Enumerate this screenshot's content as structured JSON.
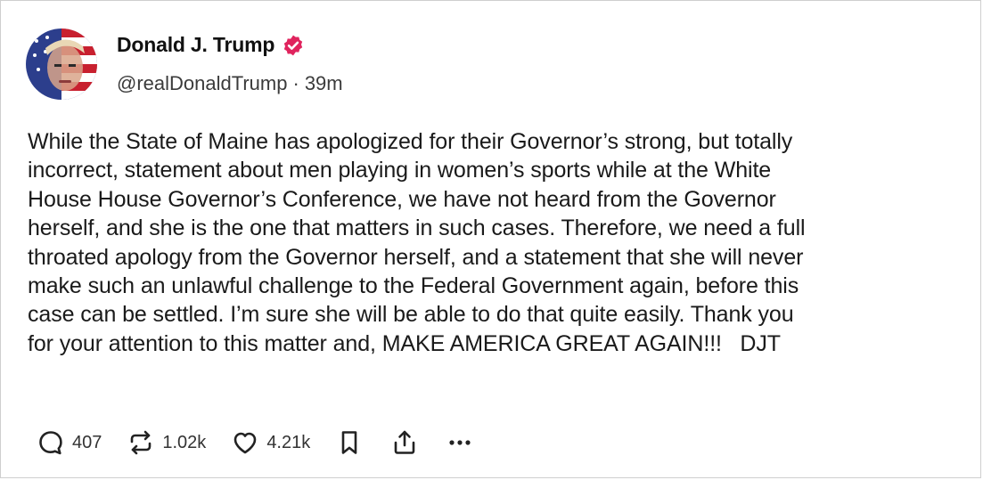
{
  "author": {
    "display_name": "Donald J. Trump",
    "handle": "@realDonaldTrump",
    "separator": "·",
    "time_ago": "39m",
    "verified": true,
    "verified_color": "#e0245e"
  },
  "post": {
    "text": "While the State of Maine has apologized for their Governor’s strong, but totally\nincorrect, statement about men playing in women’s sports while at the White\nHouse House Governor’s Conference, we have not heard from the Governor\nherself, and she is the one that matters in such cases. Therefore, we need a full\nthroated apology from the Governor herself, and a statement that she will never\nmake such an unlawful challenge to the Federal Government again, before this\ncase can be settled. I’m sure she will be able to do that quite easily. Thank you\nfor your attention to this matter and, MAKE AMERICA GREAT AGAIN!!!   DJT"
  },
  "actions": {
    "reply_count": "407",
    "repost_count": "1.02k",
    "like_count": "4.21k",
    "icons": [
      "reply-icon",
      "repost-icon",
      "like-icon",
      "bookmark-icon",
      "share-icon",
      "more-icon"
    ]
  },
  "colors": {
    "text": "#1a1a1a",
    "secondary_text": "#3b3b3b",
    "icon": "#222222"
  }
}
